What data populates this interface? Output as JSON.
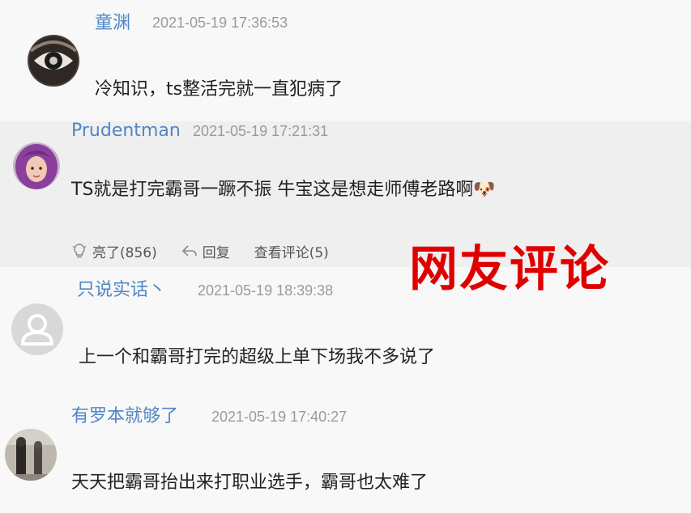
{
  "comments": [
    {
      "user": "童渊",
      "time": "2021-05-19 17:36:53",
      "text": "冷知识，ts整活完就一直犯病了",
      "avatar_icon": "eye-avatar-icon"
    },
    {
      "user": "Prudentman",
      "time": "2021-05-19 17:21:31",
      "text": "TS就是打完霸哥一蹶不振 牛宝这是想走师傅老路啊",
      "emoji": "🐶",
      "avatar_icon": "purple-hair-girl-avatar-icon",
      "actions": {
        "like": "亮了(856)",
        "reply": "回复",
        "view_replies": "查看评论(5)"
      }
    },
    {
      "user": "只说实话丶",
      "time": "2021-05-19 18:39:38",
      "text": "上一个和霸哥打完的超级上单下场我不多说了",
      "avatar_icon": "default-user-avatar-icon"
    },
    {
      "user": "有罗本就够了",
      "time": "2021-05-19 17:40:27",
      "text": "天天把霸哥抬出来打职业选手，霸哥也太难了",
      "avatar_icon": "photo-avatar-icon"
    }
  ],
  "overlay_title": "网友评论",
  "colors": {
    "username": "#4f86c6",
    "time": "#9a9a9a",
    "overlay": "#e00000",
    "highlight_bg": "#efefef"
  }
}
